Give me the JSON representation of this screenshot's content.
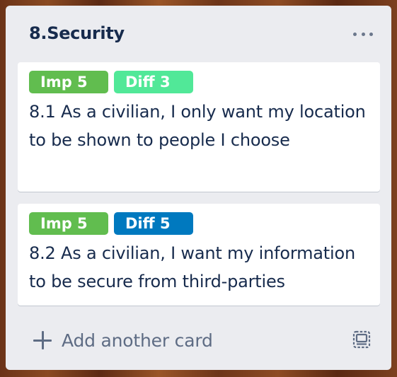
{
  "list": {
    "title": "8.Security",
    "menu_icon": "more-horizontal-icon"
  },
  "cards": [
    {
      "labels": [
        {
          "text": "Imp 5",
          "color": "#61bd4f"
        },
        {
          "text": "Diff 3",
          "color": "#51e898"
        }
      ],
      "title": "8.1 As a civilian, I only want my location to be shown to people I choose"
    },
    {
      "labels": [
        {
          "text": "Imp 5",
          "color": "#61bd4f"
        },
        {
          "text": "Diff 5",
          "color": "#0079bf"
        }
      ],
      "title": "8.2 As a civilian, I want my information to be secure from third-parties"
    }
  ],
  "composer": {
    "add_icon": "plus-icon",
    "label": "Add another card",
    "template_icon": "card-template-icon"
  }
}
